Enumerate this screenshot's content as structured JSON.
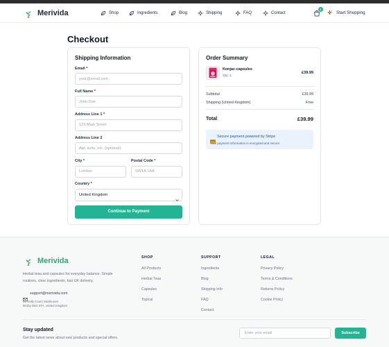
{
  "brand": {
    "name": "Merivida",
    "logo_icon": "herb-sprout-icon"
  },
  "nav": {
    "items": [
      {
        "label": "Shop",
        "icon": "leaf-icon"
      },
      {
        "label": "Ingredients",
        "icon": "leaf-icon"
      },
      {
        "label": "Blog",
        "icon": "leaf-icon"
      },
      {
        "label": "Shipping",
        "icon": "sparkle-icon"
      },
      {
        "label": "FAQ",
        "icon": "sparkle-icon"
      },
      {
        "label": "Contact",
        "icon": "sparkle-icon"
      }
    ]
  },
  "cart": {
    "icon": "shopping-bag-icon",
    "count": "1"
  },
  "header_cta": {
    "label": "Start Shopping",
    "icon": "sparkle-icon"
  },
  "page": {
    "title": "Checkout"
  },
  "shipping_form": {
    "title": "Shipping Information",
    "fields": {
      "email": {
        "label": "Email *",
        "placeholder": "your@email.com"
      },
      "full_name": {
        "label": "Full Name *",
        "placeholder": "John Doe"
      },
      "address_line_1": {
        "label": "Address Line 1 *",
        "placeholder": "123 Main Street"
      },
      "address_line_2": {
        "label": "Address Line 2",
        "placeholder": "Apt, suite, etc. (optional)"
      },
      "city": {
        "label": "City *",
        "placeholder": "London"
      },
      "postal_code": {
        "label": "Postal Code *",
        "placeholder": "SW1A 1AA"
      },
      "country": {
        "label": "Country *",
        "value": "United Kingdom"
      }
    },
    "submit_label": "Continue to Payment"
  },
  "order_summary": {
    "title": "Order Summary",
    "items": [
      {
        "name": "Konjac-capsules",
        "qty": "Qty: 1",
        "price": "£39.99"
      }
    ],
    "subtotal": {
      "label": "Subtotal",
      "value": "£39.99"
    },
    "shipping": {
      "label": "Shipping (United Kingdom)",
      "value": "Free"
    },
    "total": {
      "label": "Total",
      "value": "£39.99"
    },
    "secure_notice": {
      "icon": "credit-card-icon",
      "title": "Secure payment powered by Stripe",
      "text": "Your payment information is encrypted and secure"
    }
  },
  "footer": {
    "brand_name": "Merivida",
    "description_lines": [
      "Herbal teas and capsules for everyday balance. Simple",
      "routines, clear ingredients, fast UK delivery."
    ],
    "email": "support@merivida.com",
    "address_lines": [
      "28 Holly Court, Mickleover",
      "Derby DE3 0TA, United Kingdom"
    ],
    "columns": [
      {
        "heading": "SHOP",
        "links": [
          "All Products",
          "Herbal Teas",
          "Capsules",
          "Topical"
        ]
      },
      {
        "heading": "SUPPORT",
        "links": [
          "Ingredients",
          "Blog",
          "Shipping Info",
          "FAQ",
          "Contact"
        ]
      },
      {
        "heading": "LEGAL",
        "links": [
          "Privacy Policy",
          "Terms & Conditions",
          "Returns Policy",
          "Cookie Policy"
        ]
      }
    ],
    "newsletter": {
      "title": "Stay updated",
      "text": "Get the latest news about new products and special offers.",
      "placeholder": "Enter your email",
      "button_label": "Subscribe"
    }
  },
  "colors": {
    "accent": "#22b594",
    "text": "#1f2937",
    "brand_green": "#2fa57f",
    "info_bg": "#eaf3fd",
    "info_text": "#2563eb",
    "footer_bg": "#f7f8f8",
    "top_bar": "#2d2d2d"
  }
}
